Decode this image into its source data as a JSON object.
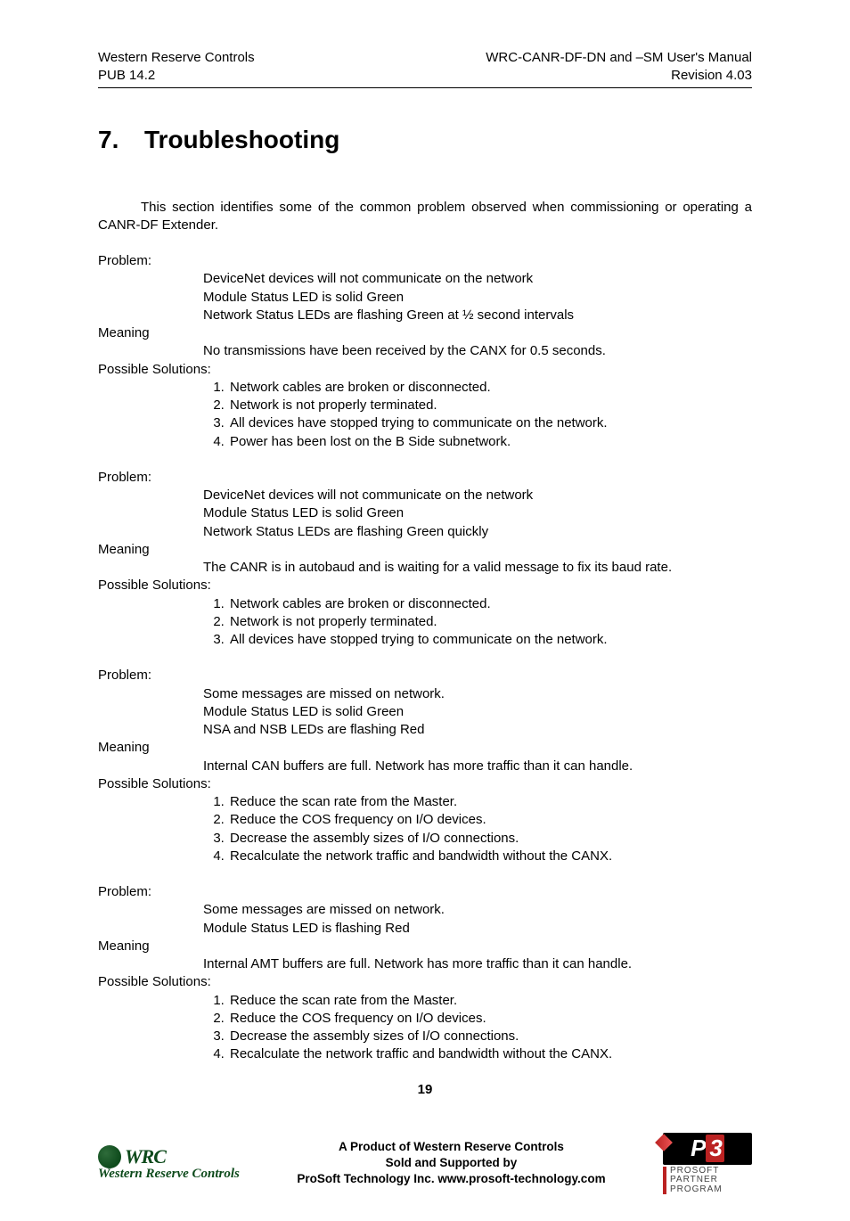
{
  "header": {
    "left_line1": "Western Reserve Controls",
    "left_line2": "PUB 14.2",
    "right_line1": "WRC-CANR-DF-DN and –SM User's Manual",
    "right_line2": "Revision 4.03"
  },
  "title_num": "7.",
  "title_text": "Troubleshooting",
  "intro": "This section identifies some of the common problem observed when commissioning or operating a CANR-DF Extender.",
  "labels": {
    "problem": "Problem:",
    "meaning": "Meaning",
    "solutions": "Possible Solutions:"
  },
  "problems": [
    {
      "symptoms": [
        "DeviceNet devices will not communicate on the network",
        "Module Status LED is solid Green",
        "Network Status LEDs are flashing Green at ½ second intervals"
      ],
      "meaning": "No transmissions have been received by the CANX for 0.5 seconds.",
      "solutions": [
        "Network cables are broken or disconnected.",
        "Network is not properly terminated.",
        "All devices have stopped trying to communicate on the network.",
        "Power has been lost on the B Side subnetwork."
      ]
    },
    {
      "symptoms": [
        "DeviceNet devices will not communicate on the network",
        "Module Status LED is solid Green",
        "Network Status LEDs are flashing Green quickly"
      ],
      "meaning": "The CANR is in autobaud and is waiting for a valid message to fix its baud rate.",
      "solutions": [
        "Network cables are broken or disconnected.",
        "Network is not properly terminated.",
        "All devices have stopped trying to communicate on the network."
      ]
    },
    {
      "symptoms": [
        "Some messages are missed on network.",
        "Module Status LED is solid Green",
        "NSA and NSB LEDs are flashing Red"
      ],
      "meaning": "Internal CAN buffers are full. Network has more traffic than it can handle.",
      "solutions": [
        "Reduce the scan rate from the Master.",
        "Reduce the COS frequency on I/O devices.",
        "Decrease the assembly sizes of I/O connections.",
        "Recalculate the network traffic and bandwidth without the CANX."
      ]
    },
    {
      "symptoms": [
        "Some messages are missed on network.",
        "Module Status LED is flashing Red"
      ],
      "meaning": "Internal AMT buffers are full. Network has more traffic than it can handle.",
      "solutions": [
        "Reduce the scan rate from the Master.",
        "Reduce the COS frequency on I/O devices.",
        "Decrease the assembly sizes of I/O connections.",
        "Recalculate the network traffic and bandwidth without the CANX."
      ]
    }
  ],
  "page_number": "19",
  "footer": {
    "line1": "A Product of Western Reserve Controls",
    "line2": "Sold and Supported by",
    "line3": "ProSoft Technology Inc. www.prosoft-technology.com",
    "wrc_abbr": "WRC",
    "wrc_full": "Western Reserve Controls",
    "p3_label": "P",
    "p3_num": "3",
    "p3_line1": "PROSOFT",
    "p3_line2": "PARTNER",
    "p3_line3": "PROGRAM"
  }
}
